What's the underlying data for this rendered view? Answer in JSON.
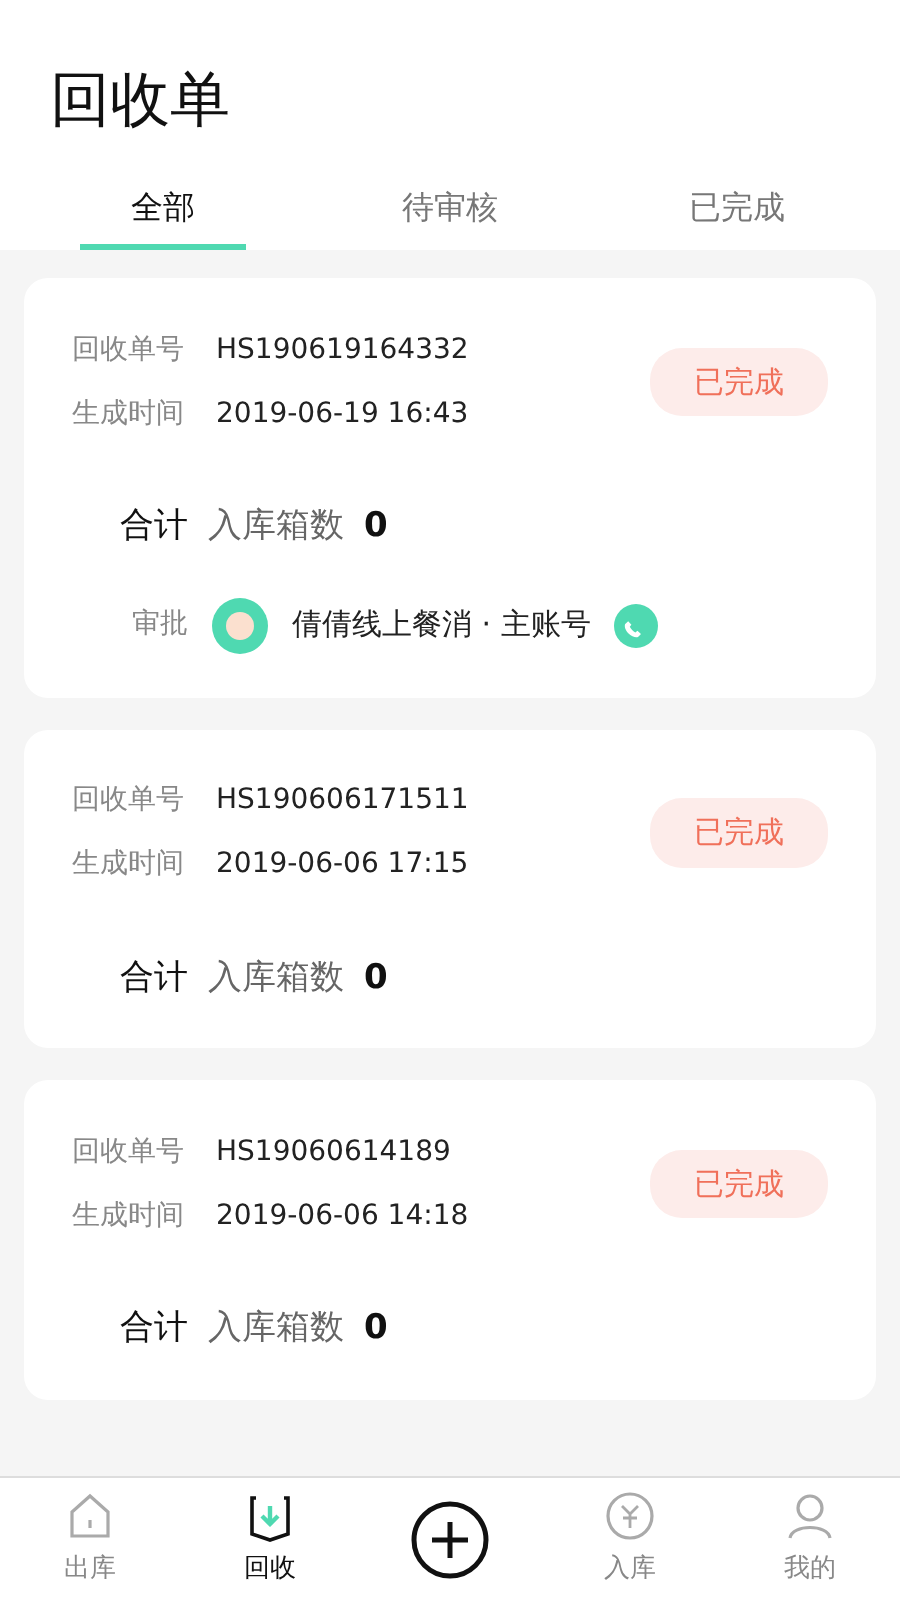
{
  "title": "回收单",
  "tabs": [
    {
      "label": "全部",
      "selected": true
    },
    {
      "label": "待审核",
      "selected": false
    },
    {
      "label": "已完成",
      "selected": false
    }
  ],
  "orders": [
    {
      "number_label": "回收单号",
      "number": "HS190619164332",
      "time_label": "生成时间",
      "time": "2019-06-19 16:43",
      "status": "已完成",
      "total_label": "合计",
      "count_label": "入库箱数",
      "count": "0",
      "approval": {
        "label": "审批",
        "name": "倩倩线上餐消 · 主账号"
      }
    },
    {
      "number_label": "回收单号",
      "number": "HS190606171511",
      "time_label": "生成时间",
      "time": "2019-06-06 17:15",
      "status": "已完成",
      "total_label": "合计",
      "count_label": "入库箱数",
      "count": "0"
    },
    {
      "number_label": "回收单号",
      "number": "HS19060614189",
      "time_label": "生成时间",
      "time": "2019-06-06 14:18",
      "status": "已完成",
      "total_label": "合计",
      "count_label": "入库箱数",
      "count": "0"
    }
  ],
  "bottom_nav": [
    {
      "kind": "home",
      "label": "出库",
      "selected": false
    },
    {
      "kind": "recycle",
      "label": "回收",
      "selected": true
    },
    {
      "kind": "add"
    },
    {
      "kind": "coin",
      "label": "入库",
      "selected": false
    },
    {
      "kind": "user",
      "label": "我的",
      "selected": false
    }
  ]
}
